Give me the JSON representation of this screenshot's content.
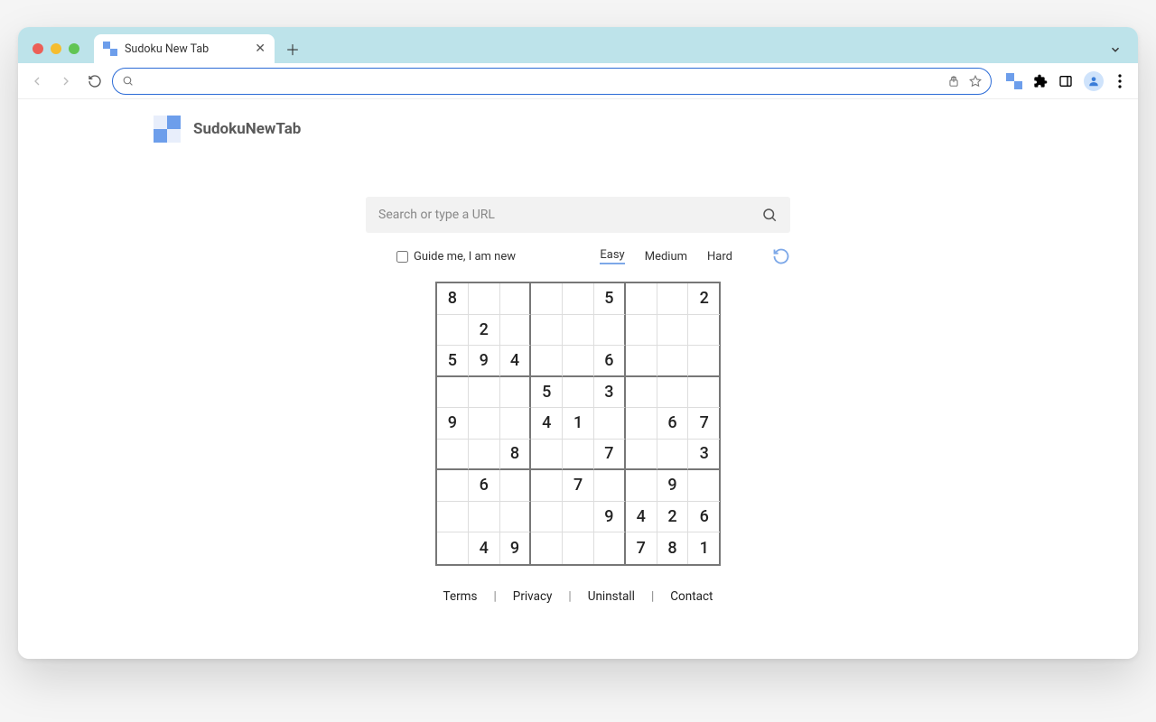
{
  "browser": {
    "tab_title": "Sudoku New Tab",
    "search_placeholder": ""
  },
  "brand": {
    "title": "SudokuNewTab"
  },
  "search": {
    "placeholder": "Search or type a URL"
  },
  "controls": {
    "guide_label": "Guide me, I am new",
    "difficulties": {
      "easy": "Easy",
      "medium": "Medium",
      "hard": "Hard"
    },
    "active": "easy"
  },
  "sudoku": {
    "grid": [
      [
        "8",
        "",
        "",
        "",
        "",
        "5",
        "",
        "",
        "2"
      ],
      [
        "",
        "2",
        "",
        "",
        "",
        "",
        "",
        "",
        ""
      ],
      [
        "5",
        "9",
        "4",
        "",
        "",
        "6",
        "",
        "",
        ""
      ],
      [
        "",
        "",
        "",
        "5",
        "",
        "3",
        "",
        "",
        ""
      ],
      [
        "9",
        "",
        "",
        "4",
        "1",
        "",
        "",
        "6",
        "7"
      ],
      [
        "",
        "",
        "8",
        "",
        "",
        "7",
        "",
        "",
        "3"
      ],
      [
        "",
        "6",
        "",
        "",
        "7",
        "",
        "",
        "9",
        ""
      ],
      [
        "",
        "",
        "",
        "",
        "",
        "9",
        "4",
        "2",
        "6"
      ],
      [
        "",
        "4",
        "9",
        "",
        "",
        "",
        "7",
        "8",
        "1"
      ]
    ]
  },
  "footer": {
    "links": [
      "Terms",
      "Privacy",
      "Uninstall",
      "Contact"
    ]
  }
}
